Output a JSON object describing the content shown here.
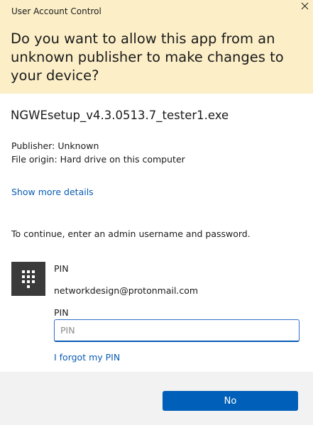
{
  "window": {
    "title": "User Account Control",
    "close_icon": "close-icon"
  },
  "header": {
    "question": "Do you want to allow this app from an unknown publisher to make changes to your device?",
    "background_color": "#fcefc8"
  },
  "app": {
    "filename": "NGWEsetup_v4.3.0513.7_tester1.exe",
    "publisher": "Publisher: Unknown",
    "file_origin": "File origin: Hard drive on this computer",
    "more_details_link": "Show more details"
  },
  "credentials": {
    "instruction": "To continue, enter an admin username and password.",
    "tile_icon": "pin-keypad-icon",
    "method_label": "PIN",
    "account": "networkdesign@protonmail.com",
    "pin_field_label": "PIN",
    "pin_placeholder": "PIN",
    "pin_value": "",
    "forgot_pin_link": "I forgot my PIN"
  },
  "footer": {
    "no_button_label": "No",
    "accent_color": "#005fb8"
  }
}
